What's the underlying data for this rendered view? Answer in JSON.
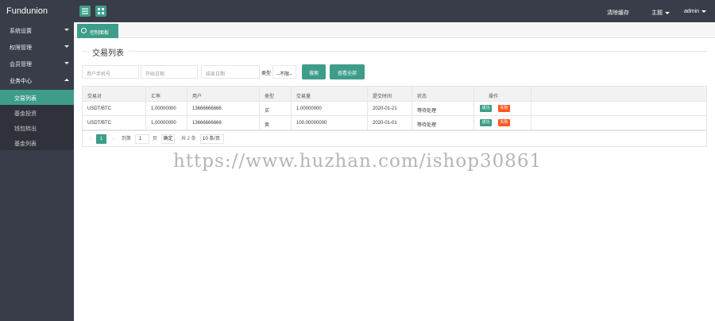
{
  "app": {
    "logo": "Fundunion"
  },
  "topbar": {
    "clear_cache": "清除缓存",
    "theme": "主题",
    "user": "admin"
  },
  "sidebar": {
    "groups": [
      {
        "label": "系统设置"
      },
      {
        "label": "权限管理"
      },
      {
        "label": "会员管理"
      },
      {
        "label": "业务中心"
      }
    ],
    "sub_items": [
      {
        "label": "交易列表"
      },
      {
        "label": "基金投资"
      },
      {
        "label": "钱包转出"
      },
      {
        "label": "基金列表"
      }
    ]
  },
  "tabs": [
    {
      "label": "控制面板"
    }
  ],
  "page": {
    "title": "交易列表"
  },
  "filters": {
    "phone_placeholder": "用户手机号",
    "start_placeholder": "开始日期",
    "end_placeholder": "结束日期",
    "type_label": "类型",
    "type_value": "--不限--",
    "search_button": "搜索",
    "query_all_button": "查看全部"
  },
  "table": {
    "headers": [
      "交易对",
      "汇率",
      "用户",
      "类型",
      "交易量",
      "提交时间",
      "状态",
      "操作"
    ],
    "rows": [
      {
        "pair": "USDT/BTC",
        "rate": "1.00000000",
        "user": "13666666666",
        "type": "买",
        "amount": "1.00000000",
        "time": "2020-01-21",
        "status": "等待处理",
        "ok": "成功",
        "fail": "失败"
      },
      {
        "pair": "USDT/BTC",
        "rate": "1.00000000",
        "user": "13666666666",
        "type": "卖",
        "amount": "100.00000000",
        "time": "2020-01-01",
        "status": "等待处理",
        "ok": "成功",
        "fail": "失败"
      }
    ]
  },
  "pager": {
    "prev": "‹",
    "current": "1",
    "next": "›",
    "goto_label": "到第",
    "goto_value": "1",
    "page_unit": "页",
    "confirm": "确定",
    "total": "共 2 条",
    "page_size": "10 条/页"
  },
  "watermark": "https://www.huzhan.com/ishop30861",
  "colors": {
    "topbar_bg": "#393d49",
    "accent": "#3e9d89",
    "danger": "#ff5722"
  }
}
